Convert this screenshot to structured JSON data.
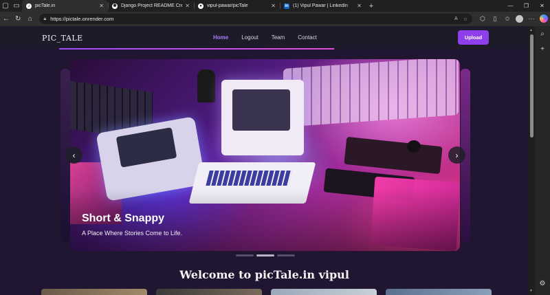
{
  "browser": {
    "tabs": [
      {
        "title": "picTale.in",
        "active": true
      },
      {
        "title": "Django Project README Creation",
        "active": false
      },
      {
        "title": "vipul-pawar/picTale",
        "active": false
      },
      {
        "title": "(1) Vipul Pawar | LinkedIn",
        "active": false
      }
    ],
    "url": "https://pictale.onrender.com"
  },
  "site": {
    "brand": "PIC_TALE",
    "nav": [
      "Home",
      "Logout",
      "Team",
      "Contact"
    ],
    "upload_label": "Upload",
    "accent": "#8f3fea"
  },
  "carousel": {
    "title": "Short & Snappy",
    "subtitle": "A Place Where Stories Come to Life.",
    "slide_count": 3,
    "active_index": 1
  },
  "welcome": "Welcome to picTale.in vipul"
}
